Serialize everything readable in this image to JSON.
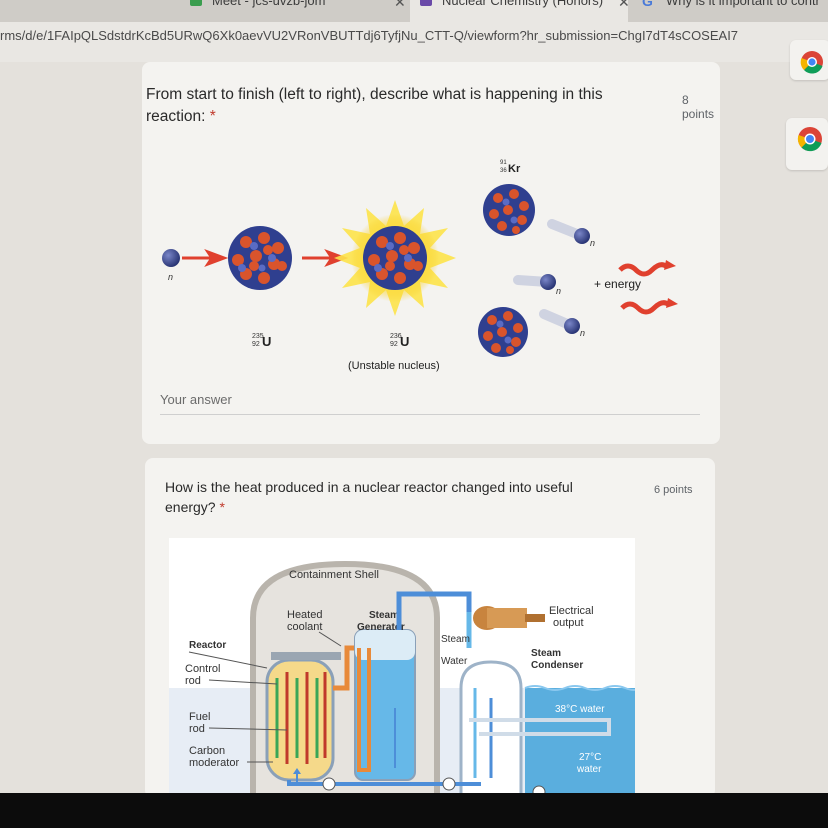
{
  "tabs": [
    {
      "label": "Meet - jcs-uvzb-jom"
    },
    {
      "label": "Nuclear Chemistry (Honors)"
    },
    {
      "label": "Why is it important to contr"
    }
  ],
  "address": {
    "url": "rms/d/e/1FAIpQLSdstdrKcBd5URwQ6Xk0aevVU2VRonVBUTTdj6TyfjNu_CTT-Q/viewform?hr_submission=ChgI7dT4sCOSEAI7"
  },
  "question1": {
    "text": "From start to finish (left to right), describe what is happening in this reaction:",
    "required": "*",
    "points": "8 points",
    "answer_placeholder": "Your answer",
    "diagram": {
      "neutron": "n",
      "u235_mass": "235",
      "u235_atomic": "92",
      "u235_symbol": "U",
      "u236_mass": "236",
      "u236_atomic": "92",
      "u236_symbol": "U",
      "u236_caption": "(Unstable nucleus)",
      "kr_mass": "91",
      "kr_atomic": "36",
      "kr_symbol": "Kr",
      "energy": "+ energy"
    }
  },
  "question2": {
    "text": "How is the heat produced in a nuclear reactor changed into useful energy?",
    "required": "*",
    "points": "6 points",
    "diagram": {
      "containment": "Containment Shell",
      "heated_coolant": [
        "Heated",
        "coolant"
      ],
      "steam_generator": [
        "Steam",
        "Generator"
      ],
      "electrical_output": [
        "Electrical",
        "output"
      ],
      "reactor": "Reactor",
      "control_rod": [
        "Control",
        "rod"
      ],
      "fuel_rod": [
        "Fuel",
        "rod"
      ],
      "carbon_moderator": [
        "Carbon",
        "moderator"
      ],
      "steam": "Steam",
      "water": "Water",
      "steam_condenser": [
        "Steam",
        "Condenser"
      ],
      "water_38": "38°C water",
      "water_27": [
        "27°C",
        "water"
      ]
    }
  },
  "colors": {
    "page_bg": "#e4e1dc",
    "card_bg": "#f4f3f0",
    "required": "#c0392b",
    "neutron": "#3b4a8a",
    "arrow_red": "#e0402e",
    "water_blue": "#5aaede"
  }
}
